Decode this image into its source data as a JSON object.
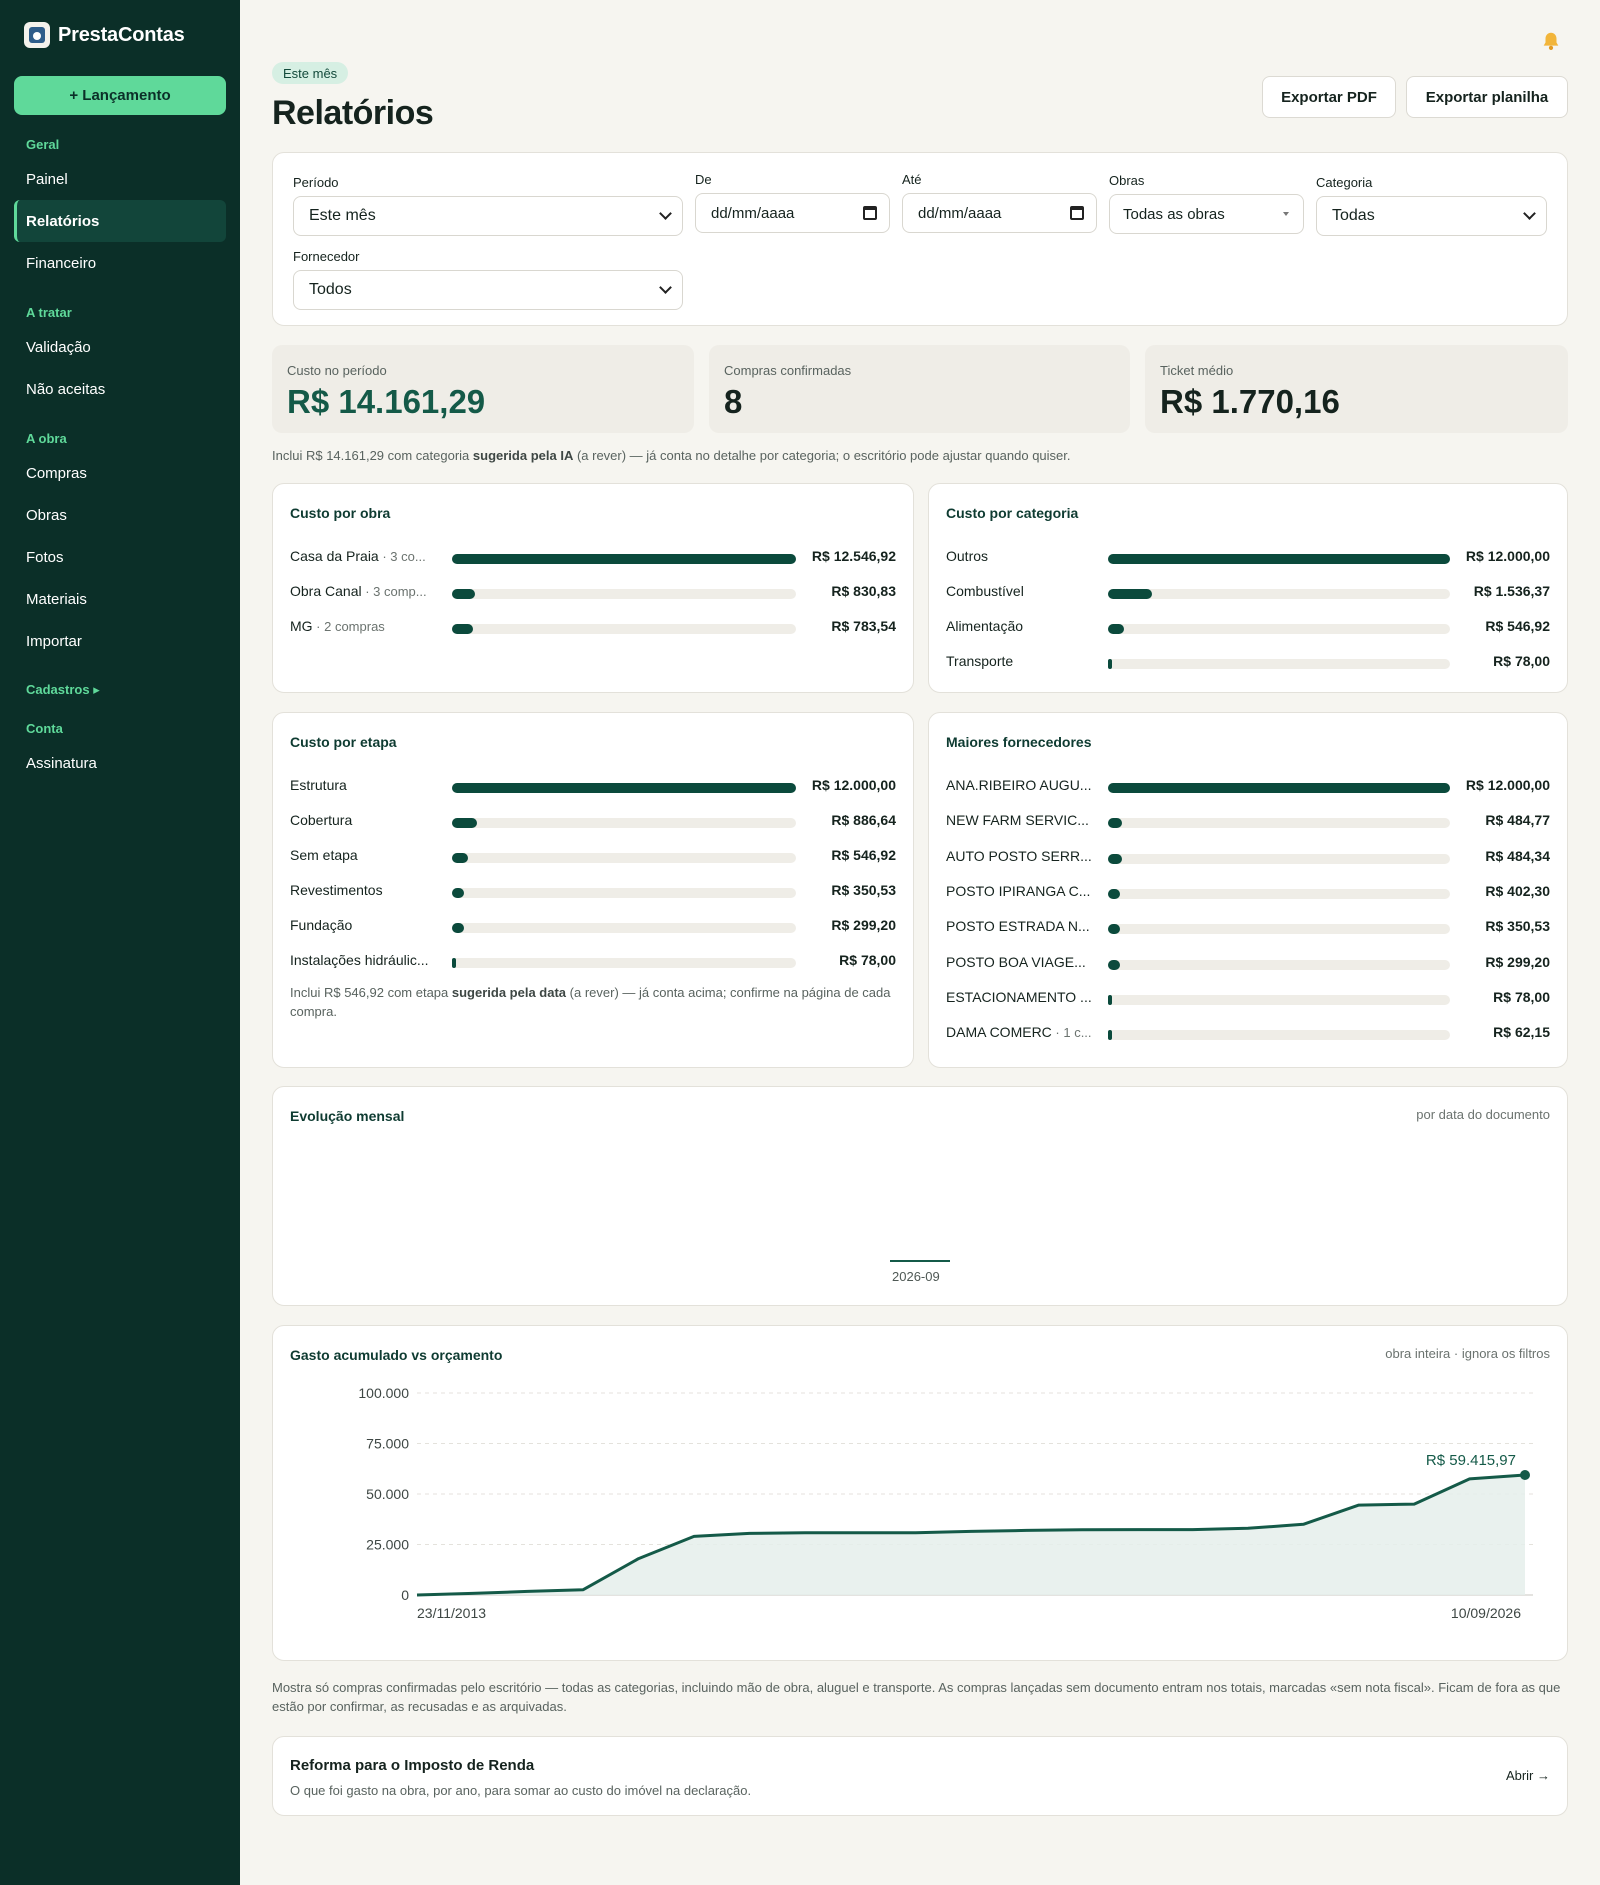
{
  "app": {
    "name": "PrestaContas",
    "new_button": "+ Lançamento"
  },
  "sidebar": {
    "groups": [
      {
        "title": "Geral",
        "items": [
          {
            "label": "Painel"
          },
          {
            "label": "Relatórios",
            "active": true
          },
          {
            "label": "Financeiro"
          }
        ]
      },
      {
        "title": "A tratar",
        "items": [
          {
            "label": "Validação"
          },
          {
            "label": "Não aceitas"
          }
        ]
      },
      {
        "title": "A obra",
        "items": [
          {
            "label": "Compras"
          },
          {
            "label": "Obras"
          },
          {
            "label": "Fotos"
          },
          {
            "label": "Materiais"
          },
          {
            "label": "Importar"
          }
        ]
      },
      {
        "title": "Cadastros ▸",
        "items": []
      },
      {
        "title": "Conta",
        "items": [
          {
            "label": "Assinatura"
          }
        ]
      }
    ]
  },
  "header": {
    "period_pill": "Este mês",
    "title": "Relatórios",
    "export_pdf": "Exportar PDF",
    "export_sheet": "Exportar planilha"
  },
  "filters": {
    "periodo": {
      "label": "Período",
      "value": "Este mês"
    },
    "de": {
      "label": "De",
      "value": "dd/mm/aaaa"
    },
    "ate": {
      "label": "Até",
      "value": "dd/mm/aaaa"
    },
    "obras": {
      "label": "Obras",
      "value": "Todas as obras"
    },
    "categoria": {
      "label": "Categoria",
      "value": "Todas"
    },
    "fornecedor": {
      "label": "Fornecedor",
      "value": "Todos"
    }
  },
  "kpis": {
    "custo": {
      "label": "Custo no período",
      "value": "R$ 14.161,29"
    },
    "compras": {
      "label": "Compras confirmadas",
      "value": "8"
    },
    "ticket": {
      "label": "Ticket médio",
      "value": "R$ 1.770,16"
    }
  },
  "notes": {
    "ia_pre": "Inclui R$ 14.161,29 com categoria ",
    "ia_bold": "sugerida pela IA",
    "ia_post": " (a rever) — já conta no detalhe por categoria; o escritório pode ajustar quando quiser.",
    "etapa_pre": "Inclui R$ 546,92 com etapa ",
    "etapa_bold": "sugerida pela data",
    "etapa_post": " (a rever) — já conta acima; confirme na página de cada compra.",
    "footer": "Mostra só compras confirmadas pelo escritório — todas as categorias, incluindo mão de obra, aluguel e transporte. As compras lançadas sem documento entram nos totais, marcadas «sem nota fiscal». Ficam de fora as que estão por confirmar, as recusadas e as arquivadas."
  },
  "custo_obra": {
    "title": "Custo por obra",
    "rows": [
      {
        "label": "Casa da Praia",
        "meta": " · 3 co...",
        "value": "R$ 12.546,92",
        "fraction": 1.0
      },
      {
        "label": "Obra Canal",
        "meta": " · 3 comp...",
        "value": "R$ 830,83",
        "fraction": 0.066
      },
      {
        "label": "MG",
        "meta": " · 2 compras",
        "value": "R$ 783,54",
        "fraction": 0.062
      }
    ]
  },
  "custo_categoria": {
    "title": "Custo por categoria",
    "rows": [
      {
        "label": "Outros",
        "meta": "",
        "value": "R$ 12.000,00",
        "fraction": 1.0
      },
      {
        "label": "Combustível",
        "meta": "",
        "value": "R$ 1.536,37",
        "fraction": 0.128
      },
      {
        "label": "Alimentação",
        "meta": "",
        "value": "R$ 546,92",
        "fraction": 0.046
      },
      {
        "label": "Transporte",
        "meta": "",
        "value": "R$ 78,00",
        "fraction": 0.0065
      }
    ]
  },
  "custo_etapa": {
    "title": "Custo por etapa",
    "rows": [
      {
        "label": "Estrutura",
        "meta": "",
        "value": "R$ 12.000,00",
        "fraction": 1.0
      },
      {
        "label": "Cobertura",
        "meta": "",
        "value": "R$ 886,64",
        "fraction": 0.074
      },
      {
        "label": "Sem etapa",
        "meta": "",
        "value": "R$ 546,92",
        "fraction": 0.046
      },
      {
        "label": "Revestimentos",
        "meta": "",
        "value": "R$ 350,53",
        "fraction": 0.029
      },
      {
        "label": "Fundação",
        "meta": "",
        "value": "R$ 299,20",
        "fraction": 0.025
      },
      {
        "label": "Instalações hidráulic...",
        "meta": "",
        "value": "R$ 78,00",
        "fraction": 0.0065
      }
    ]
  },
  "fornecedores": {
    "title": "Maiores fornecedores",
    "rows": [
      {
        "label": "ANA.RIBEIRO AUGU...",
        "meta": "",
        "value": "R$ 12.000,00",
        "fraction": 1.0
      },
      {
        "label": "NEW FARM SERVIC...",
        "meta": "",
        "value": "R$ 484,77",
        "fraction": 0.04
      },
      {
        "label": "AUTO POSTO SERR...",
        "meta": "",
        "value": "R$ 484,34",
        "fraction": 0.04
      },
      {
        "label": "POSTO IPIRANGA C...",
        "meta": "",
        "value": "R$ 402,30",
        "fraction": 0.034
      },
      {
        "label": "POSTO ESTRADA N...",
        "meta": "",
        "value": "R$ 350,53",
        "fraction": 0.029
      },
      {
        "label": "POSTO BOA VIAGE...",
        "meta": "",
        "value": "R$ 299,20",
        "fraction": 0.025
      },
      {
        "label": "ESTACIONAMENTO ...",
        "meta": "",
        "value": "R$ 78,00",
        "fraction": 0.0065
      },
      {
        "label": "DAMA COMERC",
        "meta": " · 1 c...",
        "value": "R$ 62,15",
        "fraction": 0.005
      }
    ]
  },
  "evolucao": {
    "title": "Evolução mensal",
    "subtitle": "por data do documento",
    "month": "2026-09"
  },
  "acumulado": {
    "title": "Gasto acumulado vs orçamento",
    "subtitle": "obra inteira · ignora os filtros"
  },
  "chart_data": {
    "type": "area",
    "title": "Gasto acumulado vs orçamento",
    "ylim": [
      0,
      100000
    ],
    "yticks": [
      "100.000",
      "75.000",
      "50.000",
      "25.000",
      "0"
    ],
    "ytick_values": [
      100000,
      75000,
      50000,
      25000,
      0
    ],
    "x_start_label": "23/11/2013",
    "x_end_label": "10/09/2026",
    "x_range": [
      0,
      20
    ],
    "x": [
      0,
      1,
      2,
      3,
      4,
      5,
      6,
      7,
      8,
      9,
      10,
      11,
      12,
      13,
      14,
      15,
      16,
      17,
      18,
      19,
      20
    ],
    "y": [
      0,
      800,
      1800,
      2600,
      18000,
      29000,
      30500,
      30800,
      30800,
      30800,
      31500,
      32000,
      32300,
      32400,
      32400,
      33000,
      35000,
      44500,
      45000,
      57500,
      59415.97
    ],
    "last_label": "R$ 59.415,97",
    "grid": true
  },
  "ir": {
    "title": "Reforma para o Imposto de Renda",
    "subtitle": "O que foi gasto na obra, por ano, para somar ao custo do imóvel na declaração.",
    "link": "Abrir →"
  },
  "colors": {
    "sidebar": "#0b2f28",
    "accent": "#5fd99a",
    "bar": "#0b4a3c",
    "line": "#145a48"
  }
}
